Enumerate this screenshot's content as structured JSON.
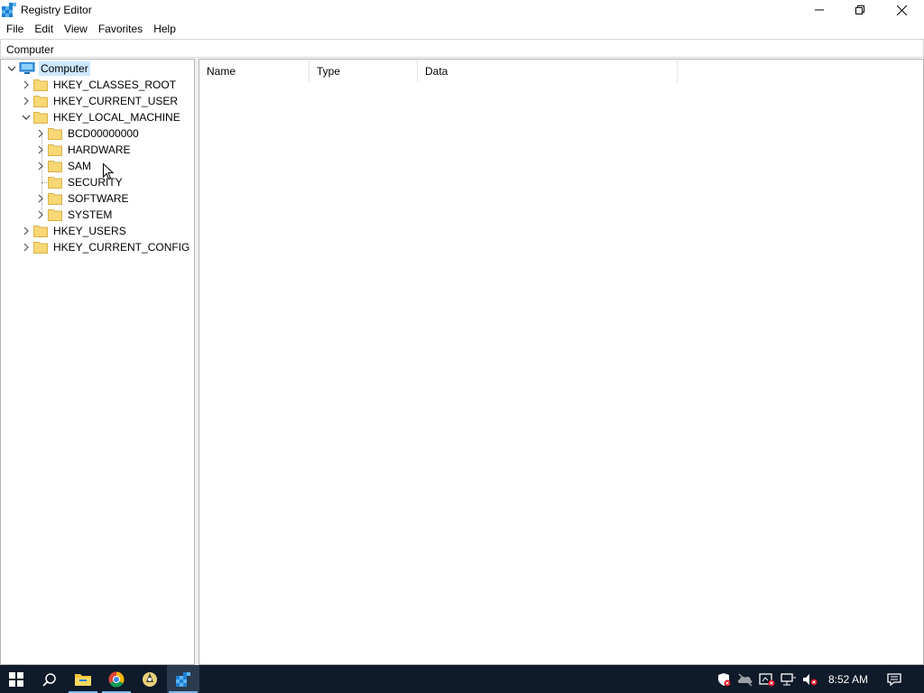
{
  "window": {
    "title": "Registry Editor"
  },
  "menu": {
    "items": [
      "File",
      "Edit",
      "View",
      "Favorites",
      "Help"
    ]
  },
  "address": {
    "path": "Computer"
  },
  "tree": {
    "root": "Computer",
    "hives": {
      "classes_root": "HKEY_CLASSES_ROOT",
      "current_user": "HKEY_CURRENT_USER",
      "local_machine": "HKEY_LOCAL_MACHINE",
      "users": "HKEY_USERS",
      "current_config": "HKEY_CURRENT_CONFIG"
    },
    "local_machine_children": [
      "BCD00000000",
      "HARDWARE",
      "SAM",
      "SECURITY",
      "SOFTWARE",
      "SYSTEM"
    ]
  },
  "columns": {
    "name": "Name",
    "type": "Type",
    "data": "Data"
  },
  "taskbar": {
    "time": "8:52 AM"
  },
  "colors": {
    "accent": "#0078d7",
    "folder": "#f8d775",
    "taskbar": "#0f1a2a",
    "selection": "#cce8ff"
  }
}
